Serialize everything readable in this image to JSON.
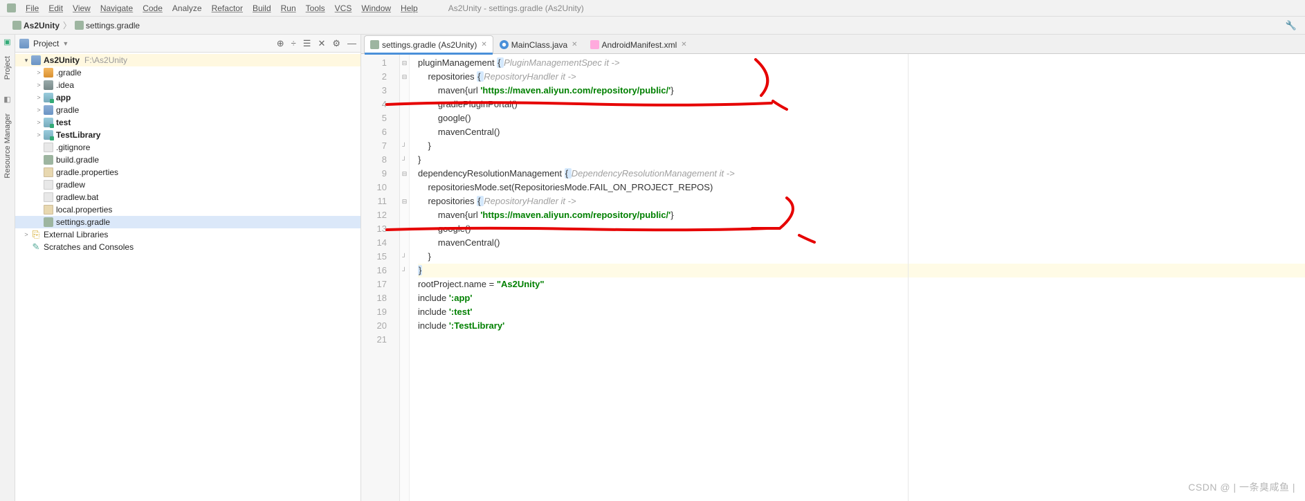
{
  "menu": {
    "items": [
      "File",
      "Edit",
      "View",
      "Navigate",
      "Code",
      "Analyze",
      "Refactor",
      "Build",
      "Run",
      "Tools",
      "VCS",
      "Window",
      "Help"
    ],
    "title": "As2Unity - settings.gradle (As2Unity)"
  },
  "breadcrumb": {
    "root": "As2Unity",
    "file": "settings.gradle"
  },
  "project_header": {
    "title": "Project",
    "tools": [
      "⊕",
      "÷",
      "☰",
      "✕",
      "⚙",
      "—"
    ]
  },
  "tree": {
    "root": {
      "name": "As2Unity",
      "path": "F:\\As2Unity"
    },
    "children": [
      {
        "name": ".gradle",
        "icon": "folder-orange",
        "arrow": ">"
      },
      {
        "name": ".idea",
        "icon": "folder-dark",
        "arrow": ">"
      },
      {
        "name": "app",
        "icon": "module",
        "bold": true,
        "arrow": ">"
      },
      {
        "name": "gradle",
        "icon": "folder",
        "arrow": ">"
      },
      {
        "name": "test",
        "icon": "module",
        "bold": true,
        "arrow": ">"
      },
      {
        "name": "TestLibrary",
        "icon": "module",
        "bold": true,
        "arrow": ">"
      },
      {
        "name": ".gitignore",
        "icon": "file",
        "arrow": ""
      },
      {
        "name": "build.gradle",
        "icon": "elephant",
        "arrow": ""
      },
      {
        "name": "gradle.properties",
        "icon": "prop",
        "arrow": ""
      },
      {
        "name": "gradlew",
        "icon": "file",
        "arrow": ""
      },
      {
        "name": "gradlew.bat",
        "icon": "file",
        "arrow": ""
      },
      {
        "name": "local.properties",
        "icon": "prop",
        "arrow": ""
      },
      {
        "name": "settings.gradle",
        "icon": "elephant",
        "arrow": "",
        "selected": true
      }
    ],
    "extras": [
      {
        "name": "External Libraries",
        "icon": "lib",
        "arrow": ">"
      },
      {
        "name": "Scratches and Consoles",
        "icon": "scratch",
        "arrow": ""
      }
    ]
  },
  "tabs": [
    {
      "label": "settings.gradle (As2Unity)",
      "icon": "gradle",
      "active": true
    },
    {
      "label": "MainClass.java",
      "icon": "java",
      "active": false
    },
    {
      "label": "AndroidManifest.xml",
      "icon": "xml",
      "active": false
    }
  ],
  "code": {
    "lines": [
      {
        "n": 1,
        "segs": [
          [
            "",
            "pluginManagement "
          ],
          [
            "brace-hl",
            "{ "
          ],
          [
            "hint",
            "PluginManagementSpec it ->"
          ]
        ]
      },
      {
        "n": 2,
        "segs": [
          [
            "",
            "    repositories "
          ],
          [
            "brace-hl",
            "{ "
          ],
          [
            "hint",
            "RepositoryHandler it ->"
          ]
        ]
      },
      {
        "n": 3,
        "segs": [
          [
            "",
            "        maven{url "
          ],
          [
            "str",
            "'https://maven.aliyun.com/repository/public/'"
          ],
          [
            "",
            "}"
          ]
        ]
      },
      {
        "n": 4,
        "segs": [
          [
            "",
            "        gradlePluginPortal()"
          ]
        ]
      },
      {
        "n": 5,
        "segs": [
          [
            "",
            "        google()"
          ]
        ]
      },
      {
        "n": 6,
        "segs": [
          [
            "",
            "        mavenCentral()"
          ]
        ]
      },
      {
        "n": 7,
        "segs": [
          [
            "",
            "    }"
          ]
        ]
      },
      {
        "n": 8,
        "segs": [
          [
            "",
            "}"
          ]
        ]
      },
      {
        "n": 9,
        "segs": [
          [
            "",
            "dependencyResolutionManagement "
          ],
          [
            "brace-hl",
            "{ "
          ],
          [
            "hint",
            "DependencyResolutionManagement it ->"
          ]
        ]
      },
      {
        "n": 10,
        "segs": [
          [
            "",
            "    repositoriesMode.set(RepositoriesMode.FAIL_ON_PROJECT_REPOS)"
          ]
        ]
      },
      {
        "n": 11,
        "segs": [
          [
            "",
            "    repositories "
          ],
          [
            "brace-hl",
            "{ "
          ],
          [
            "hint",
            "RepositoryHandler it ->"
          ]
        ]
      },
      {
        "n": 12,
        "segs": [
          [
            "",
            "        maven{url "
          ],
          [
            "str",
            "'https://maven.aliyun.com/repository/public/'"
          ],
          [
            "",
            "}"
          ]
        ]
      },
      {
        "n": 13,
        "segs": [
          [
            "",
            "        google()"
          ]
        ]
      },
      {
        "n": 14,
        "segs": [
          [
            "",
            "        mavenCentral()"
          ]
        ]
      },
      {
        "n": 15,
        "segs": [
          [
            "",
            "    }"
          ]
        ]
      },
      {
        "n": 16,
        "hl": true,
        "segs": [
          [
            "brace-hl",
            "}"
          ]
        ]
      },
      {
        "n": 17,
        "segs": [
          [
            "",
            "rootProject.name = "
          ],
          [
            "str",
            "\"As2Unity\""
          ]
        ]
      },
      {
        "n": 18,
        "segs": [
          [
            "",
            "include "
          ],
          [
            "str",
            "':app'"
          ]
        ]
      },
      {
        "n": 19,
        "segs": [
          [
            "",
            "include "
          ],
          [
            "str",
            "':test'"
          ]
        ]
      },
      {
        "n": 20,
        "segs": [
          [
            "",
            "include "
          ],
          [
            "str",
            "':TestLibrary'"
          ]
        ]
      },
      {
        "n": 21,
        "segs": [
          [
            "",
            ""
          ]
        ]
      }
    ]
  },
  "watermark": "CSDN @ | 一条臭咸鱼 |",
  "left_tabs": [
    "Project",
    "Resource Manager"
  ]
}
